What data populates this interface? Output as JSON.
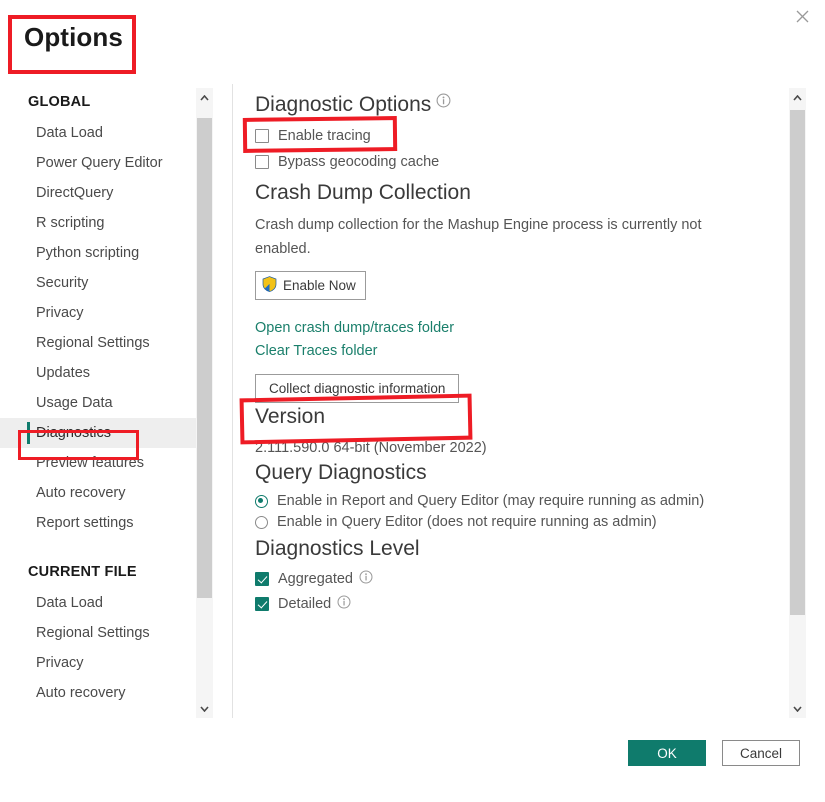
{
  "window": {
    "title": "Options",
    "close_icon": "close-icon"
  },
  "sidebar": {
    "groups": [
      {
        "label": "GLOBAL",
        "items": [
          {
            "label": "Data Load",
            "active": false
          },
          {
            "label": "Power Query Editor",
            "active": false
          },
          {
            "label": "DirectQuery",
            "active": false
          },
          {
            "label": "R scripting",
            "active": false
          },
          {
            "label": "Python scripting",
            "active": false
          },
          {
            "label": "Security",
            "active": false
          },
          {
            "label": "Privacy",
            "active": false
          },
          {
            "label": "Regional Settings",
            "active": false
          },
          {
            "label": "Updates",
            "active": false
          },
          {
            "label": "Usage Data",
            "active": false
          },
          {
            "label": "Diagnostics",
            "active": true
          },
          {
            "label": "Preview features",
            "active": false
          },
          {
            "label": "Auto recovery",
            "active": false
          },
          {
            "label": "Report settings",
            "active": false
          }
        ]
      },
      {
        "label": "CURRENT FILE",
        "items": [
          {
            "label": "Data Load",
            "active": false
          },
          {
            "label": "Regional Settings",
            "active": false
          },
          {
            "label": "Privacy",
            "active": false
          },
          {
            "label": "Auto recovery",
            "active": false
          }
        ]
      }
    ]
  },
  "main": {
    "diagnostic_options": {
      "heading": "Diagnostic Options",
      "info_icon": "info-icon",
      "checkboxes": [
        {
          "label": "Enable tracing",
          "checked": false
        },
        {
          "label": "Bypass geocoding cache",
          "checked": false
        }
      ]
    },
    "crash_dump": {
      "heading": "Crash Dump Collection",
      "description": "Crash dump collection for the Mashup Engine process is currently not enabled.",
      "enable_button": "Enable Now",
      "shield_icon": "uac-shield-icon",
      "links": [
        "Open crash dump/traces folder",
        "Clear Traces folder"
      ],
      "collect_button": "Collect diagnostic information"
    },
    "version": {
      "heading": "Version",
      "value": "2.111.590.0 64-bit (November 2022)"
    },
    "query_diagnostics": {
      "heading": "Query Diagnostics",
      "options": [
        {
          "label": "Enable in Report and Query Editor (may require running as admin)",
          "selected": true
        },
        {
          "label": "Enable in Query Editor (does not require running as admin)",
          "selected": false
        }
      ]
    },
    "diagnostics_level": {
      "heading": "Diagnostics Level",
      "checkboxes": [
        {
          "label": "Aggregated",
          "checked": true,
          "info_icon": "info-icon"
        },
        {
          "label": "Detailed",
          "checked": true,
          "info_icon": "info-icon"
        }
      ]
    }
  },
  "footer": {
    "ok_label": "OK",
    "cancel_label": "Cancel"
  },
  "colors": {
    "accent": "#0f7b6c",
    "link": "#1a7f6b",
    "annotation": "#ee1c25",
    "selected_row_bg": "#eeeeee"
  },
  "annotations": [
    {
      "name": "options-title-highlight"
    },
    {
      "name": "diagnostics-nav-highlight"
    },
    {
      "name": "enable-tracing-highlight"
    },
    {
      "name": "collect-diagnostic-information-highlight"
    }
  ]
}
